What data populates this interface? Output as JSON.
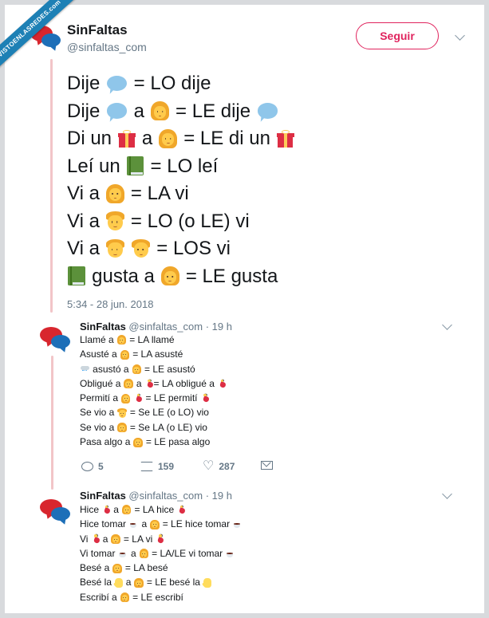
{
  "watermark": "VISTOENLASREDES.com",
  "tweet": {
    "name": "SinFaltas",
    "handle": "@sinfaltas_com",
    "follow_label": "Seguir",
    "lines": [
      [
        {
          "t": "Dije "
        },
        {
          "e": "speech-bubble"
        },
        {
          "t": " = LO dije"
        }
      ],
      [
        {
          "t": "Dije "
        },
        {
          "e": "speech-bubble"
        },
        {
          "t": " a "
        },
        {
          "e": "woman"
        },
        {
          "t": " = LE dije "
        },
        {
          "e": "speech-bubble"
        }
      ],
      [
        {
          "t": "Di un "
        },
        {
          "e": "gift"
        },
        {
          "t": " a "
        },
        {
          "e": "woman"
        },
        {
          "t": " = LE di un "
        },
        {
          "e": "gift"
        }
      ],
      [
        {
          "t": "Leí un "
        },
        {
          "e": "book"
        },
        {
          "t": " = LO leí"
        }
      ],
      [
        {
          "t": "Vi a "
        },
        {
          "e": "woman"
        },
        {
          "t": " = LA vi"
        }
      ],
      [
        {
          "t": "Vi a "
        },
        {
          "e": "boy"
        },
        {
          "t": " = LO (o LE) vi"
        }
      ],
      [
        {
          "t": "Vi a "
        },
        {
          "e": "boy"
        },
        {
          "t": " "
        },
        {
          "e": "boy"
        },
        {
          "t": " = LOS vi"
        }
      ],
      [
        {
          "e": "book"
        },
        {
          "t": " gusta a "
        },
        {
          "e": "woman"
        },
        {
          "t": " = LE gusta"
        }
      ]
    ],
    "timestamp": "5:34 - 28 jun. 2018"
  },
  "replies": [
    {
      "name": "SinFaltas",
      "handle": "@sinfaltas_com",
      "time": "· 19 h",
      "lines": [
        [
          {
            "t": "Llamé a "
          },
          {
            "e": "woman"
          },
          {
            "t": " = LA llamé"
          }
        ],
        [
          {
            "t": "Asusté a "
          },
          {
            "e": "woman"
          },
          {
            "t": " = LA asusté"
          }
        ],
        [
          {
            "e": "storm"
          },
          {
            "t": " asustó a "
          },
          {
            "e": "woman"
          },
          {
            "t": " = LE asustó"
          }
        ],
        [
          {
            "t": "Obligué a "
          },
          {
            "e": "woman"
          },
          {
            "t": " a "
          },
          {
            "e": "dancer"
          },
          {
            "t": "= LA obligué a "
          },
          {
            "e": "dancer"
          }
        ],
        [
          {
            "t": "Permití a "
          },
          {
            "e": "woman"
          },
          {
            "t": " "
          },
          {
            "e": "dancer"
          },
          {
            "t": " = LE permití "
          },
          {
            "e": "dancer"
          }
        ],
        [
          {
            "t": "Se vio a "
          },
          {
            "e": "boy"
          },
          {
            "t": " = Se LE (o LO) vio"
          }
        ],
        [
          {
            "t": "Se vio a "
          },
          {
            "e": "woman"
          },
          {
            "t": " = Se LA (o LE) vio"
          }
        ],
        [
          {
            "t": "Pasa algo a "
          },
          {
            "e": "woman"
          },
          {
            "t": " = LE pasa algo"
          }
        ]
      ],
      "actions": {
        "replies": "5",
        "retweets": "159",
        "likes": "287"
      }
    },
    {
      "name": "SinFaltas",
      "handle": "@sinfaltas_com",
      "time": "· 19 h",
      "lines": [
        [
          {
            "t": "Hice "
          },
          {
            "e": "dancer"
          },
          {
            "t": " a "
          },
          {
            "e": "woman"
          },
          {
            "t": " = LA hice "
          },
          {
            "e": "dancer"
          }
        ],
        [
          {
            "t": "Hice tomar "
          },
          {
            "e": "coffee"
          },
          {
            "t": " a "
          },
          {
            "e": "woman"
          },
          {
            "t": " = LE hice tomar "
          },
          {
            "e": "coffee"
          }
        ],
        [
          {
            "t": "Vi "
          },
          {
            "e": "dancer"
          },
          {
            "t": " a "
          },
          {
            "e": "woman"
          },
          {
            "t": " = LA vi "
          },
          {
            "e": "dancer"
          }
        ],
        [
          {
            "t": "Vi tomar "
          },
          {
            "e": "coffee"
          },
          {
            "t": " a "
          },
          {
            "e": "woman"
          },
          {
            "t": " = LA/LE vi tomar "
          },
          {
            "e": "coffee"
          }
        ],
        [
          {
            "t": "Besé a "
          },
          {
            "e": "woman"
          },
          {
            "t": " = LA besé"
          }
        ],
        [
          {
            "t": "Besé la "
          },
          {
            "e": "hand"
          },
          {
            "t": " a "
          },
          {
            "e": "woman"
          },
          {
            "t": " = LE besé la "
          },
          {
            "e": "hand"
          }
        ],
        [
          {
            "t": "Escribí a "
          },
          {
            "e": "woman"
          },
          {
            "t": " = LE escribí"
          }
        ]
      ]
    }
  ]
}
